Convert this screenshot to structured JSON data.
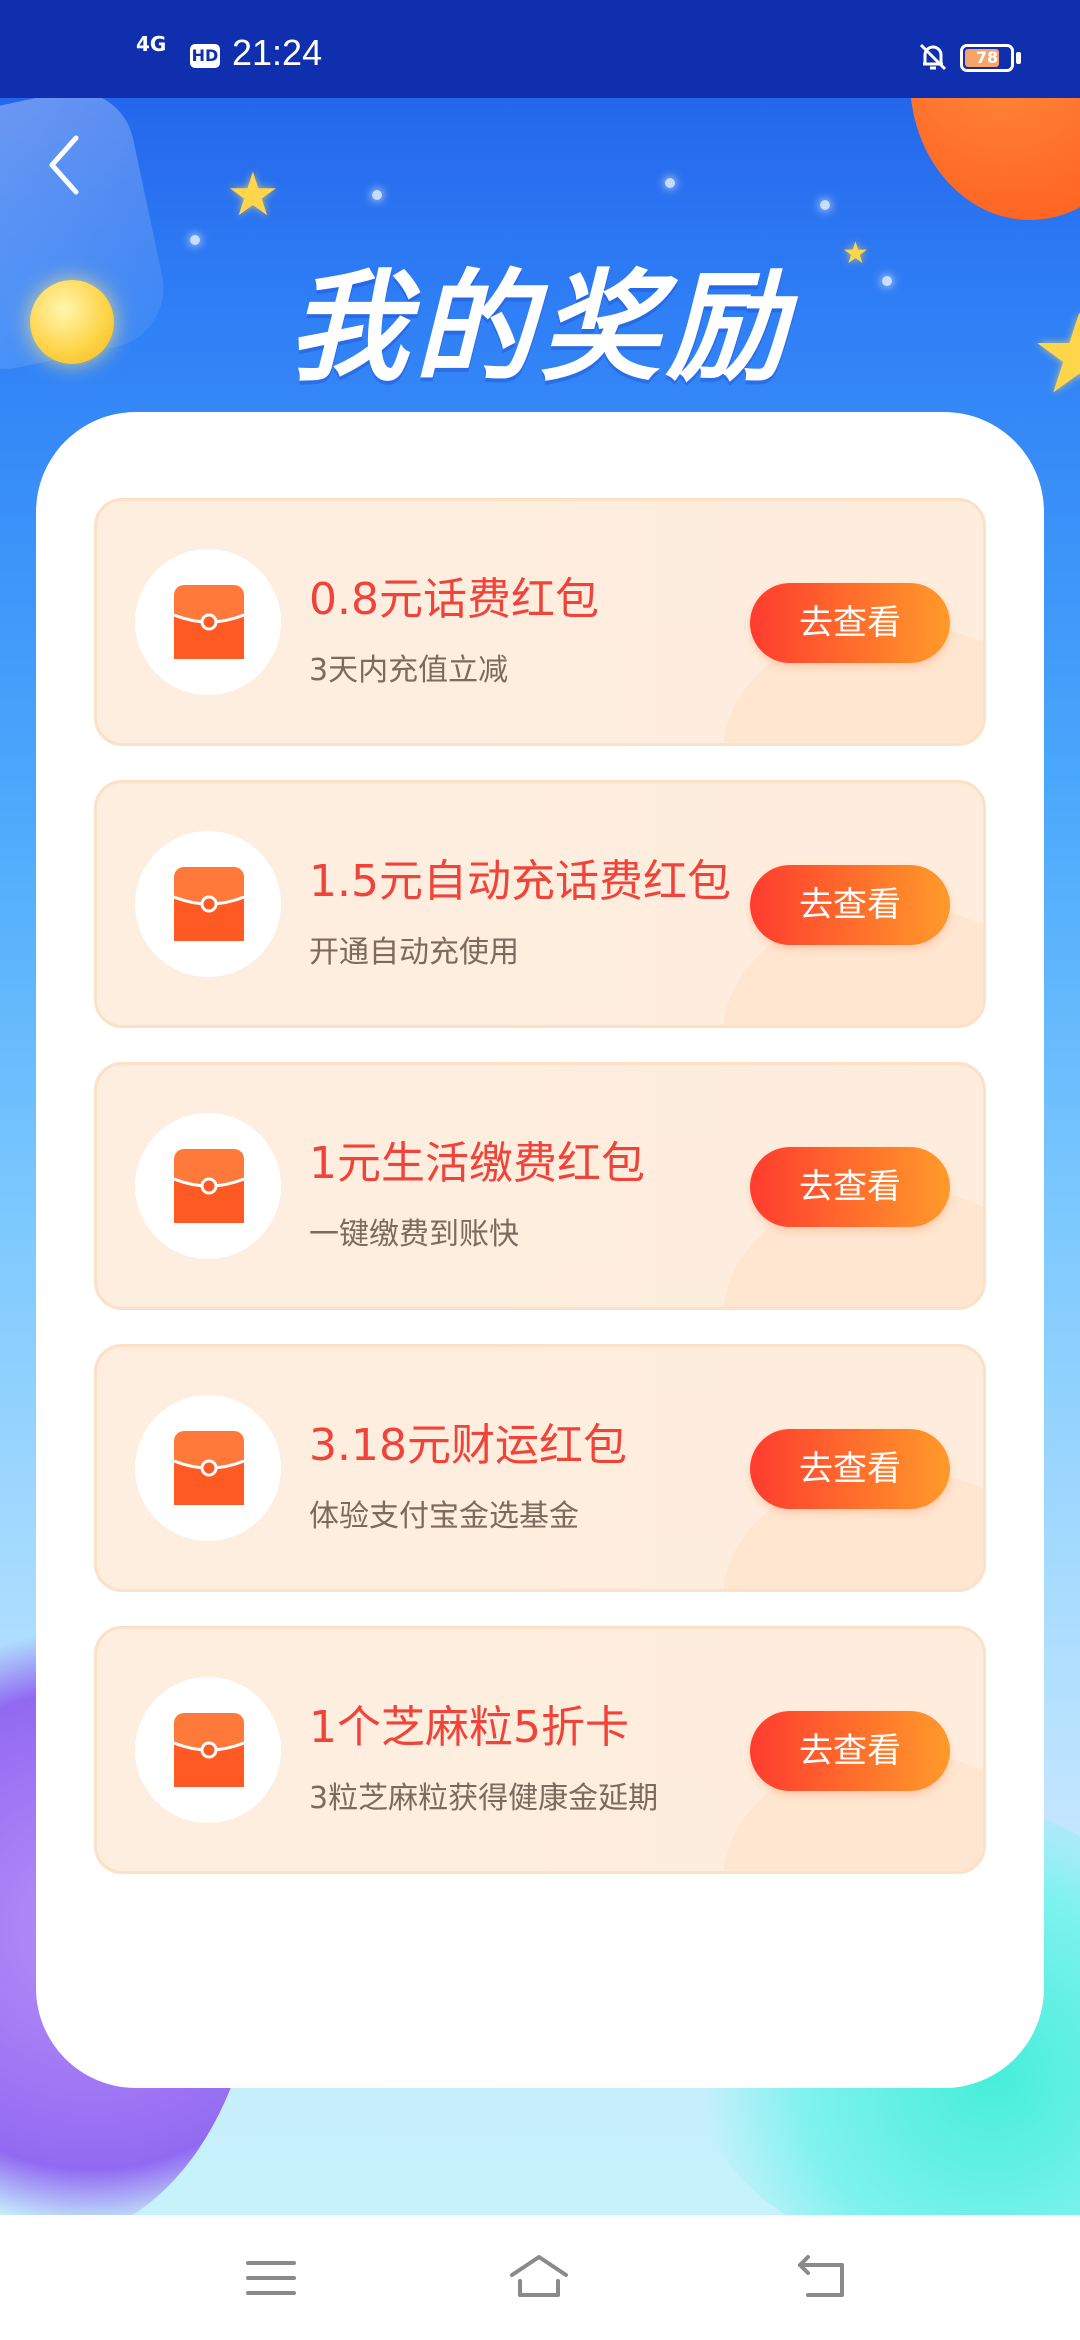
{
  "status_bar": {
    "network": "4G",
    "hd": "HD",
    "time": "21:24",
    "battery": "78"
  },
  "header": {
    "title": "我的奖励"
  },
  "rewards": [
    {
      "title": "0.8元话费红包",
      "subtitle": "3天内充值立减",
      "button": "去查看"
    },
    {
      "title": "1.5元自动充话费红包",
      "subtitle": "开通自动充使用",
      "button": "去查看"
    },
    {
      "title": "1元生活缴费红包",
      "subtitle": "一键缴费到账快",
      "button": "去查看"
    },
    {
      "title": "3.18元财运红包",
      "subtitle": "体验支付宝金选基金",
      "button": "去查看"
    },
    {
      "title": "1个芝麻粒5折卡",
      "subtitle": "3粒芝麻粒获得健康金延期",
      "button": "去查看"
    }
  ],
  "battery_level": 0.78,
  "colors": {
    "accent": "#f0443a",
    "button_start": "#ff3b2f",
    "button_end": "#ff9a2a",
    "status_bar": "#0f2fae"
  },
  "icons": {
    "back": "chevron-left-icon",
    "wallet": "wallet-icon",
    "menu": "menu-icon",
    "home": "home-icon",
    "back_nav": "back-icon",
    "mute": "bell-off-icon"
  }
}
